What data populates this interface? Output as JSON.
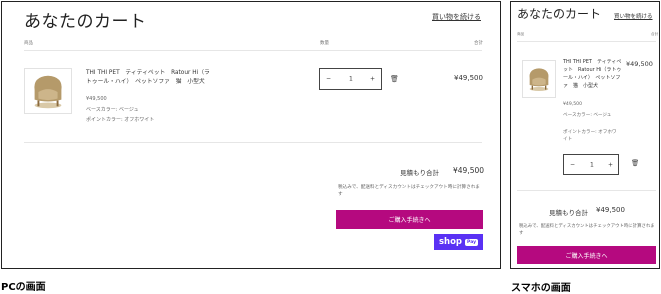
{
  "captions": {
    "pc": "PCの画面",
    "sp": "スマホの画面"
  },
  "cart": {
    "title": "あなたのカート",
    "continue_shopping": "買い物を続ける",
    "headers": {
      "product": "商品",
      "quantity": "数量",
      "total": "合計"
    },
    "product": {
      "name": "THI THI PET　ティティペット　Ratour Hi（ラトゥール・ハイ）　ペットソファ　猫　小型犬",
      "unit_price": "¥49,500",
      "base_color": "ベースカラー: ベージュ",
      "point_color": "ポイントカラー: オフホワイト",
      "quantity": "1",
      "line_total": "¥49,500"
    },
    "quantity_controls": {
      "minus": "−",
      "plus": "+"
    },
    "estimate_label": "見積もり合計",
    "estimate_value": "¥49,500",
    "tax_note": "税込みで、配送料とディスカウントはチェックアウト時に計算されます",
    "checkout_label": "ご購入手続きへ",
    "shop_pay": {
      "label": "shop",
      "badge": "Pay"
    }
  },
  "colors": {
    "checkout": "#b5097f",
    "shop_pay": "#5a31f4"
  }
}
